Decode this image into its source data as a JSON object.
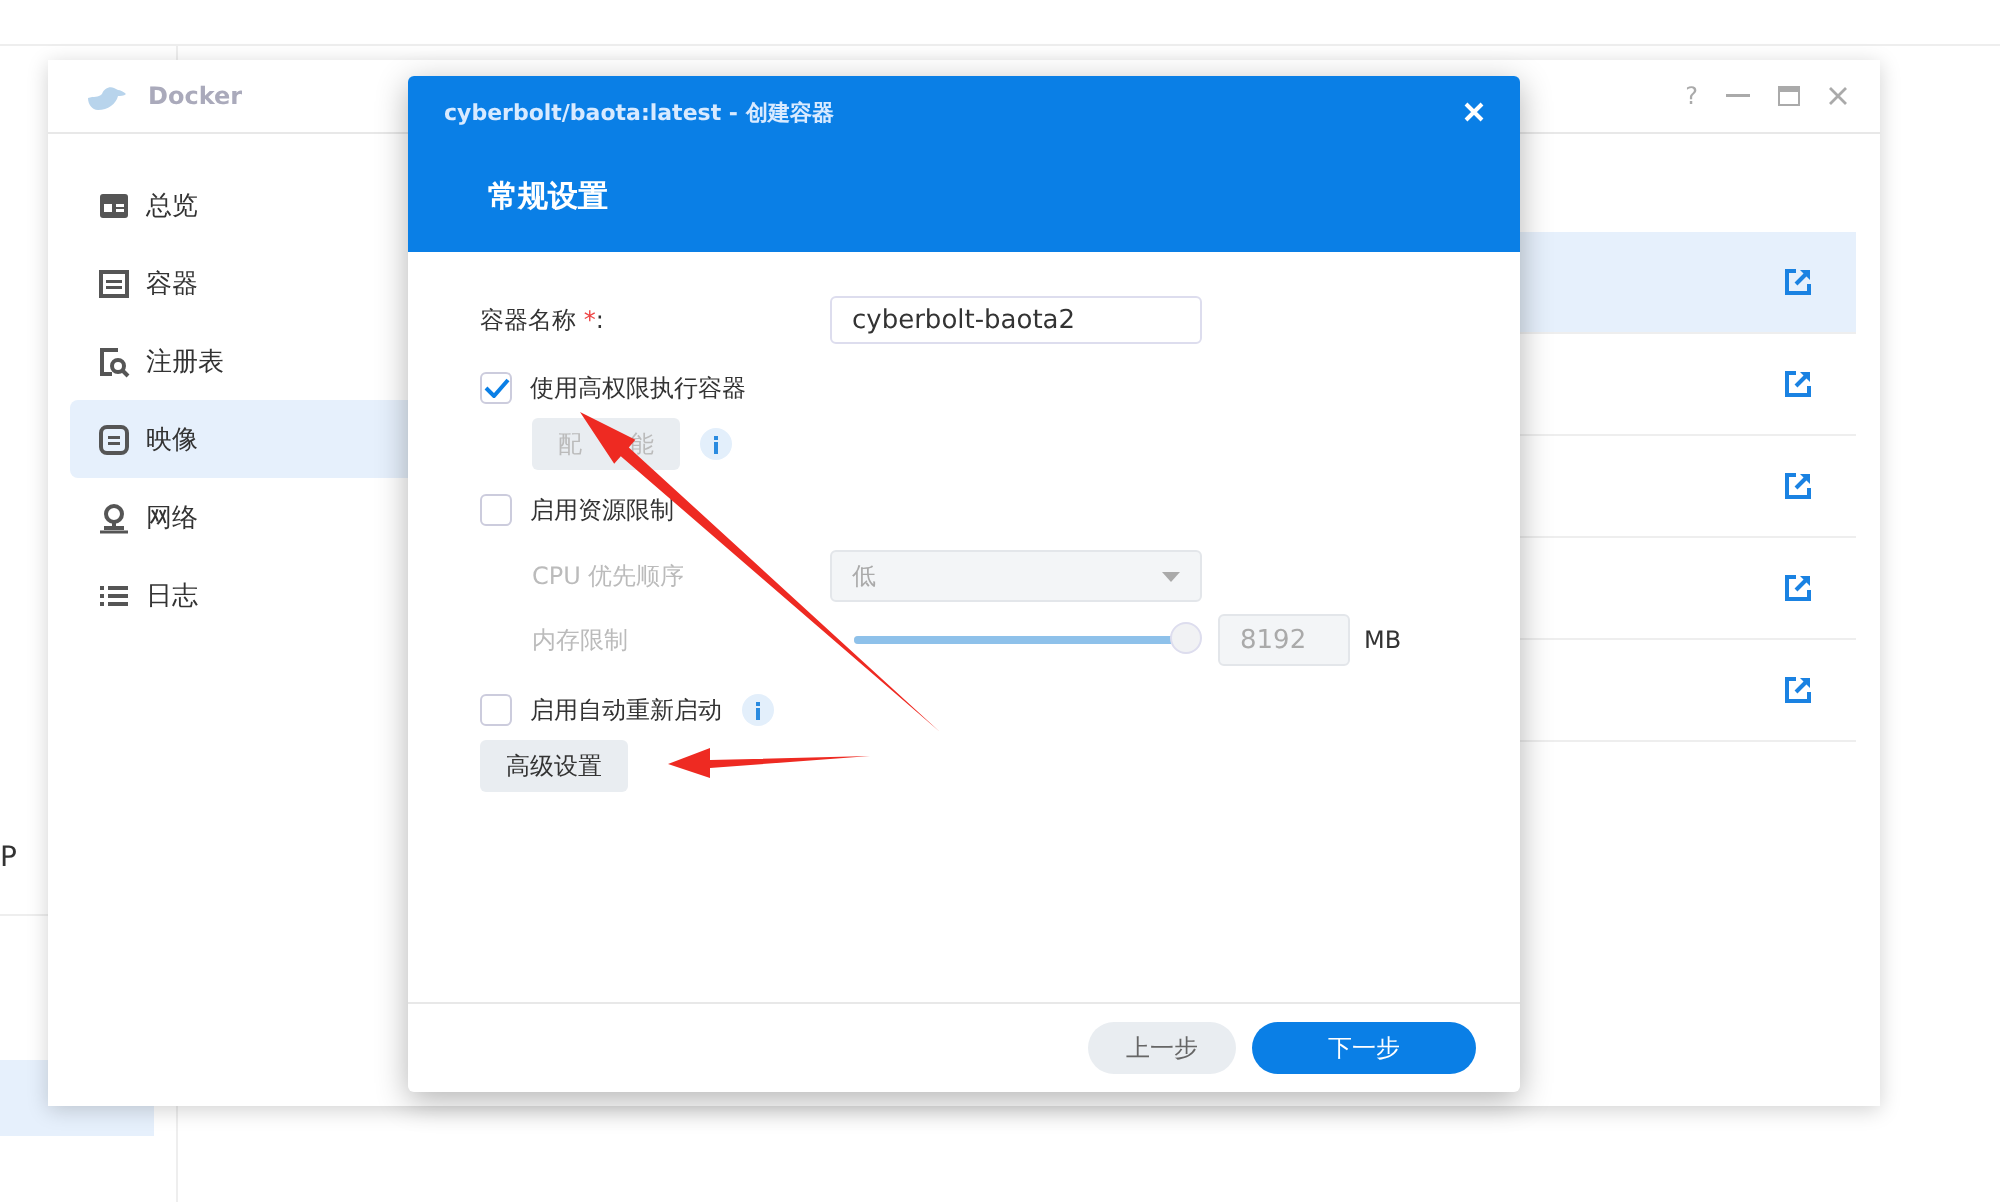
{
  "background": {
    "label": "P"
  },
  "window": {
    "title": "Docker",
    "help": "?"
  },
  "sidebar": {
    "items": [
      {
        "label": "总览",
        "selected": false
      },
      {
        "label": "容器",
        "selected": false
      },
      {
        "label": "注册表",
        "selected": false
      },
      {
        "label": "映像",
        "selected": true
      },
      {
        "label": "网络",
        "selected": false
      },
      {
        "label": "日志",
        "selected": false
      }
    ]
  },
  "rows": [
    {
      "selected": true
    },
    {
      "selected": false
    },
    {
      "selected": false
    },
    {
      "selected": false
    },
    {
      "selected": false
    }
  ],
  "dialog": {
    "title": "cyberbolt/baota:latest - 创建容器",
    "header": "常规设置",
    "name_field": {
      "label": "容器名称",
      "required_mark": "*",
      "colon": ":",
      "value": "cyberbolt-baota2"
    },
    "privileged": {
      "label": "使用高权限执行容器",
      "checked": true,
      "button": {
        "label_parts": [
          "配",
          "能"
        ],
        "disabled": true
      }
    },
    "resource_limit": {
      "label": "启用资源限制",
      "checked": false,
      "cpu": {
        "label": "CPU 优先顺序",
        "value": "低",
        "disabled": true
      },
      "memory": {
        "label": "内存限制",
        "level": 1,
        "value": "8192",
        "unit": "MB",
        "disabled": true
      }
    },
    "auto_restart": {
      "label": "启用自动重新启动",
      "checked": false
    },
    "advanced_button": "高级设置",
    "buttons": [
      {
        "label": "上一步",
        "kind": "secondary"
      },
      {
        "label": "下一步",
        "kind": "primary"
      }
    ]
  }
}
